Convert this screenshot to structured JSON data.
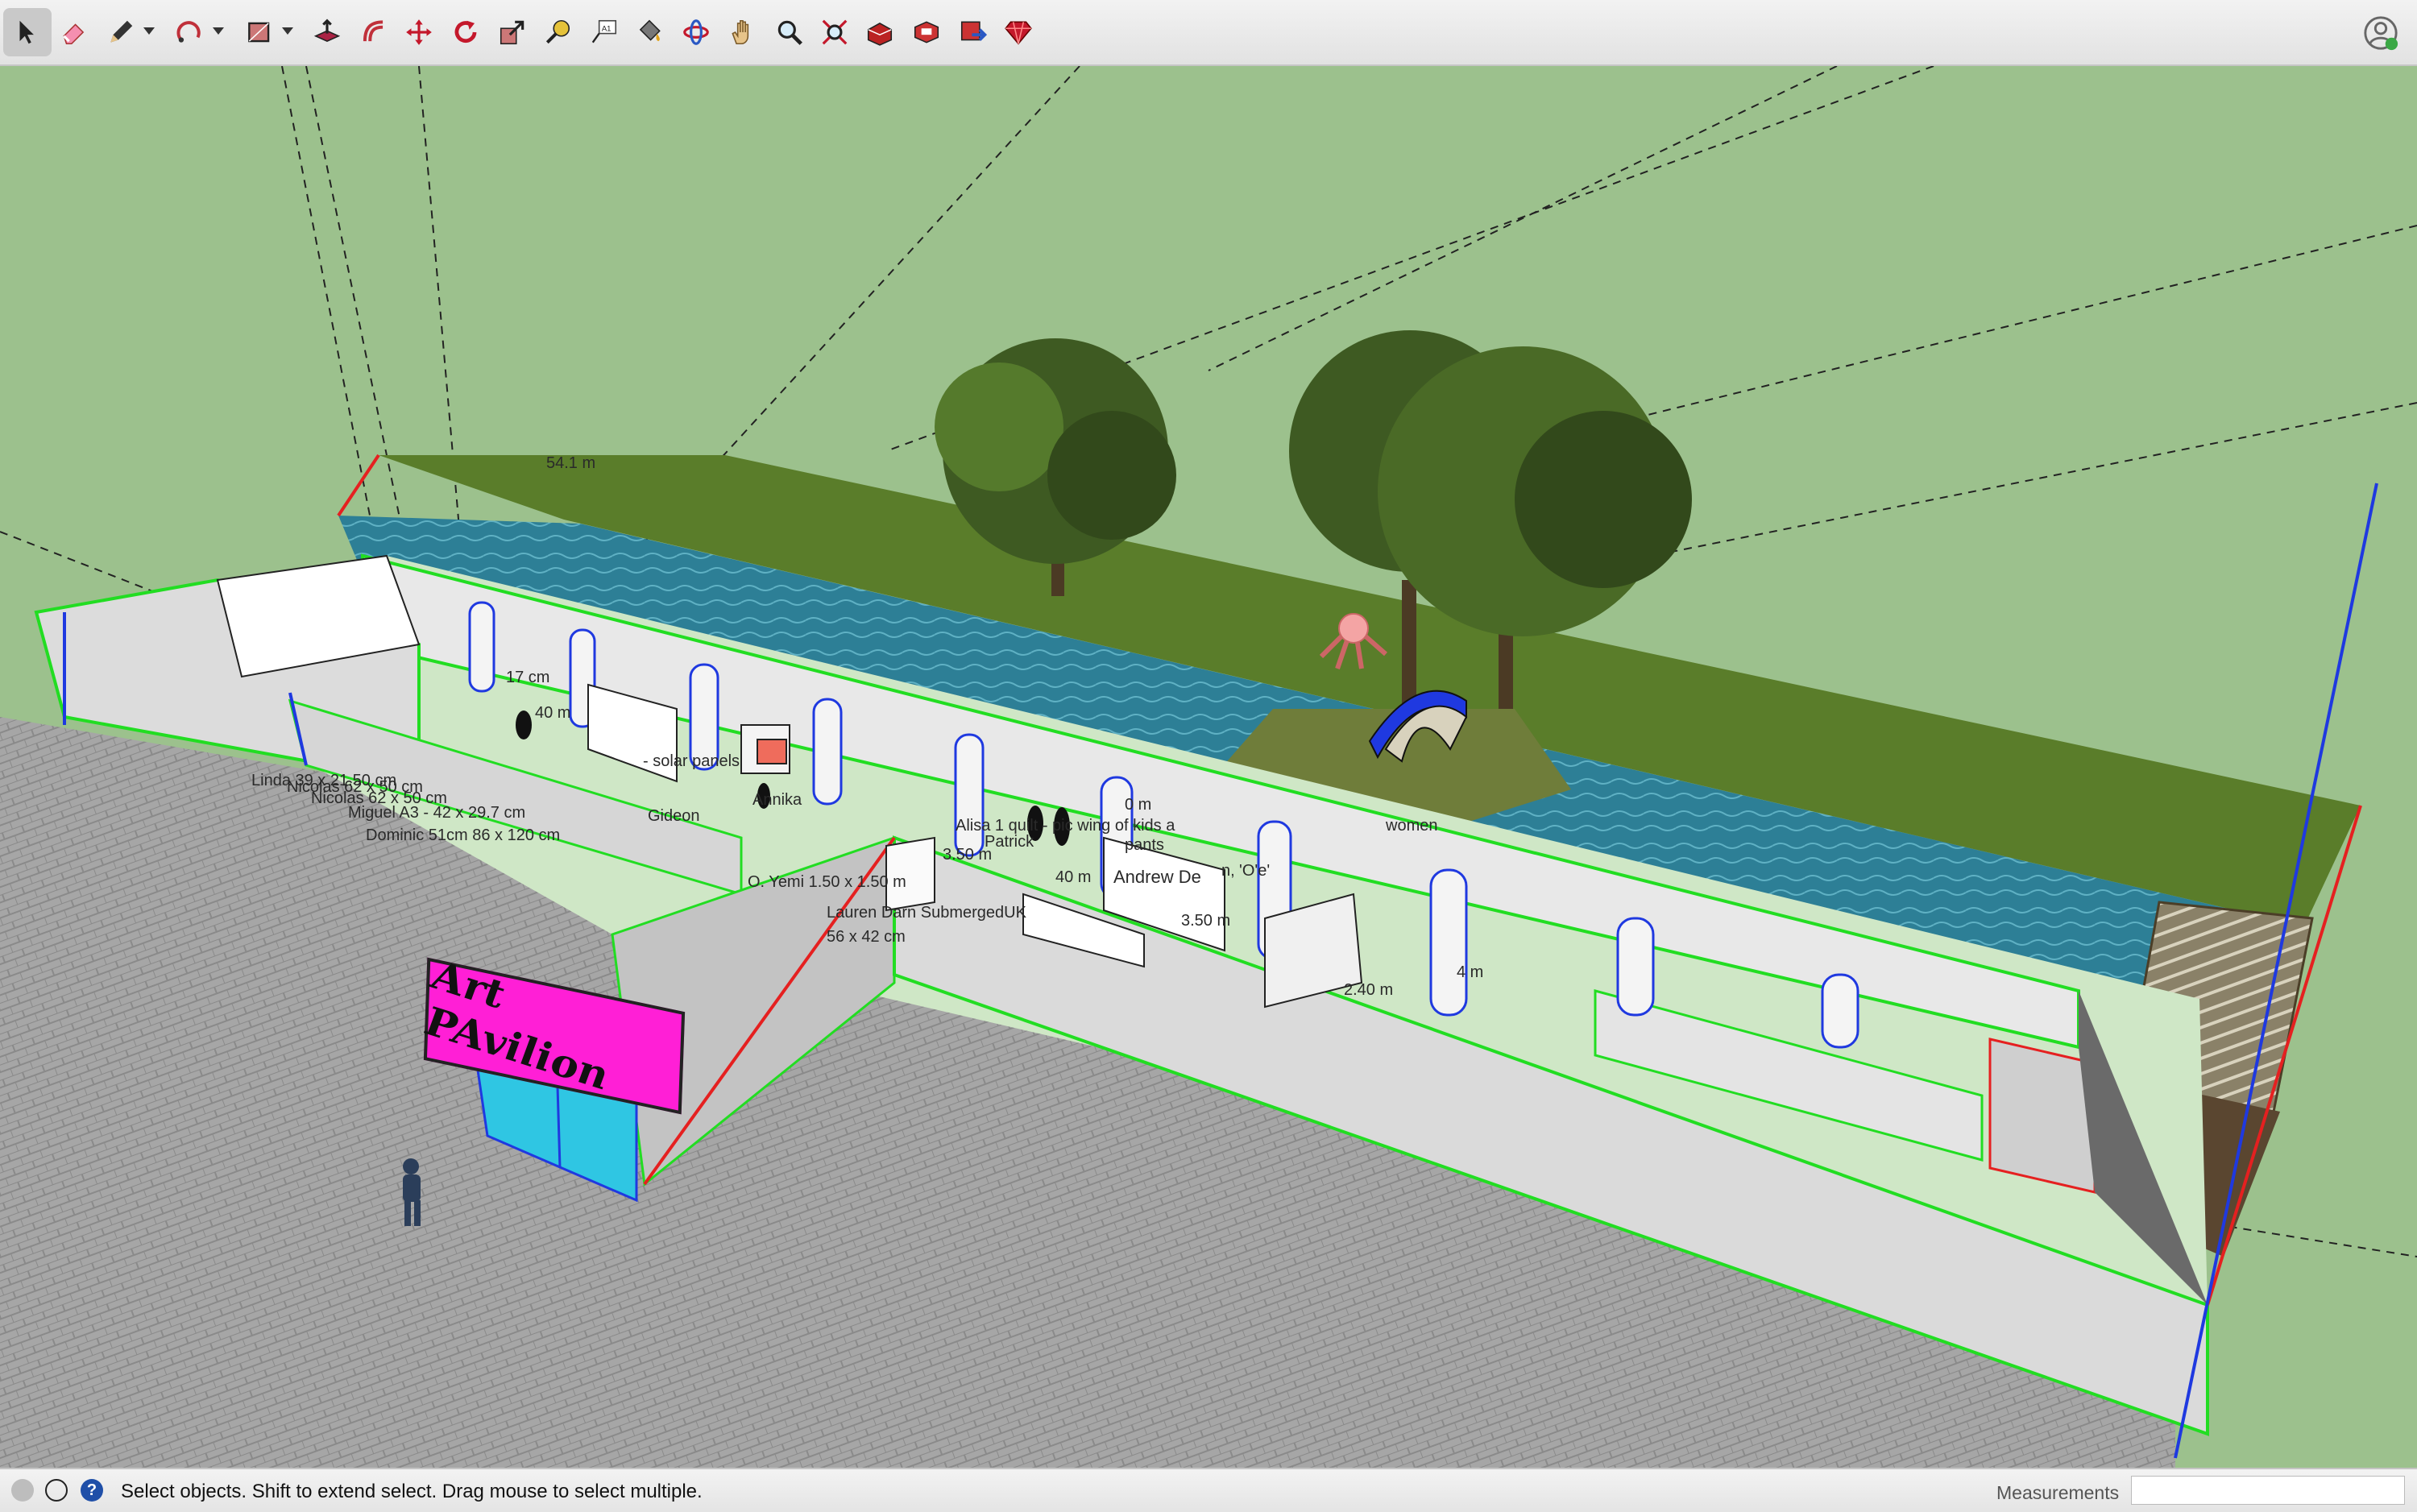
{
  "toolbar": {
    "tools": [
      {
        "name": "select-tool",
        "icon": "arrow-cursor-icon"
      },
      {
        "name": "eraser-tool",
        "icon": "eraser-icon"
      },
      {
        "name": "pencil-line-tool",
        "icon": "pencil-icon"
      },
      {
        "name": "arc-tool",
        "icon": "arc-icon"
      },
      {
        "name": "shape-tool",
        "icon": "rectangle-icon"
      },
      {
        "name": "push-pull-tool",
        "icon": "push-pull-icon"
      },
      {
        "name": "offset-tool",
        "icon": "offset-icon"
      },
      {
        "name": "move-tool",
        "icon": "move-icon"
      },
      {
        "name": "rotate-tool",
        "icon": "rotate-icon"
      },
      {
        "name": "scale-tool",
        "icon": "scale-icon"
      },
      {
        "name": "tape-measure-tool",
        "icon": "tape-measure-icon"
      },
      {
        "name": "text-tool",
        "icon": "text-icon"
      },
      {
        "name": "paint-bucket-tool",
        "icon": "paint-bucket-icon"
      },
      {
        "name": "orbit-tool",
        "icon": "orbit-icon"
      },
      {
        "name": "pan-tool",
        "icon": "hand-icon"
      },
      {
        "name": "zoom-tool",
        "icon": "magnifier-icon"
      },
      {
        "name": "zoom-extents-tool",
        "icon": "zoom-extents-icon"
      },
      {
        "name": "warehouse-tool",
        "icon": "warehouse-icon"
      },
      {
        "name": "extension-warehouse-tool",
        "icon": "extension-icon"
      },
      {
        "name": "send-to-layout-tool",
        "icon": "layout-icon"
      },
      {
        "name": "ruby-console-tool",
        "icon": "ruby-icon"
      }
    ],
    "account_icon": "user-profile-icon"
  },
  "scene": {
    "sign_text": "Art PAvilion",
    "labels": [
      "54.1 m",
      "17 cm",
      "40 m",
      "- solar panels",
      "Annika",
      "Gideon",
      "Linda 39 x 21.50 cm",
      "Nicolas 62 x 50 cm",
      "Nicolas 62 x 50 cm",
      "Miguel A3 - 42 x 29.7 cm",
      "Dominic 51cm 86 x 120 cm",
      "Alisa 1 quilt - pic wing of kids a",
      "3.50 m",
      "Patrick",
      "pants",
      "0 m",
      "O. Yemi 1.50 x 1.50 m",
      "40 m",
      "Andrew De",
      "'O'e'",
      "Lauren Darn SubmergedUK",
      "56 x 42 cm",
      "3.50 m",
      "2.40 m",
      "4 m",
      "women",
      "n,"
    ]
  },
  "status": {
    "text": "Select objects. Shift to extend select. Drag mouse to select multiple.",
    "measurements_label": "Measurements",
    "measurements_value": ""
  },
  "colors": {
    "ground": "#9cc18d",
    "water": "#2d7f96",
    "grass_strip": "#5a7d2a",
    "edge_green": "#22dd22",
    "edge_red": "#e52020",
    "edge_blue": "#1f39e0",
    "sign": "#ff1fd6",
    "glass": "#2fc6e3"
  }
}
